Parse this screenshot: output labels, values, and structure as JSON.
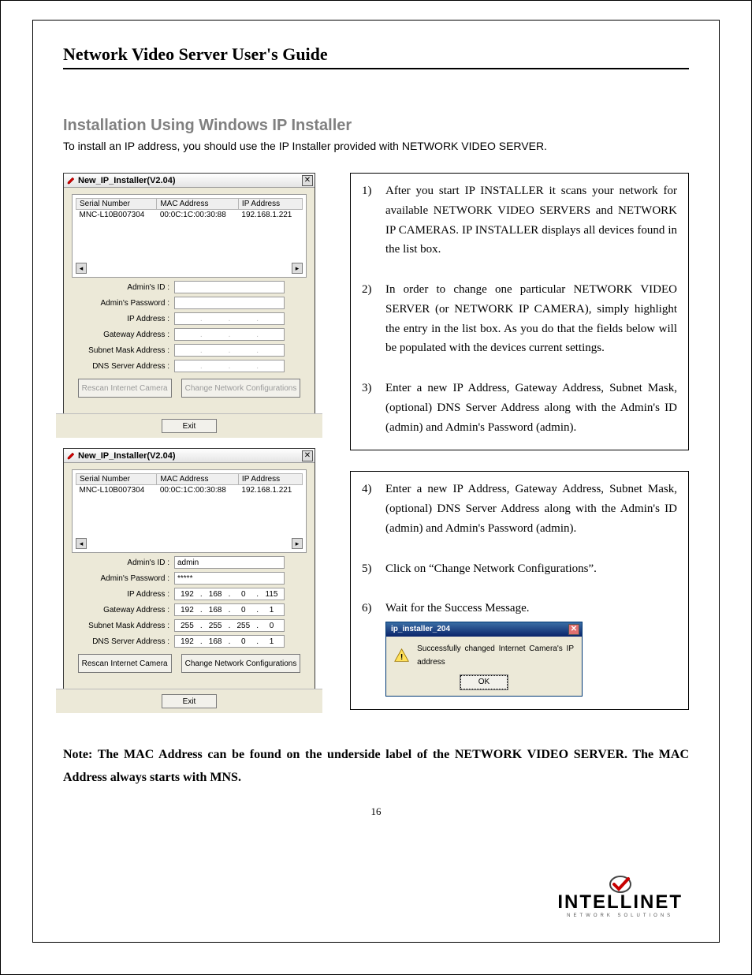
{
  "doc": {
    "title": "Network Video Server User's Guide",
    "section_title": "Installation Using Windows IP Installer",
    "intro": "To install an IP address, you should use the IP Installer provided with NETWORK VIDEO SERVER.",
    "note": "Note: The MAC Address can be found on the underside label of the NETWORK VIDEO SERVER. The MAC Address always starts with MNS.",
    "page_number": "16",
    "brand_name": "INTELLINET",
    "brand_sub": "NETWORK SOLUTIONS"
  },
  "installer": {
    "window_title": "New_IP_Installer(V2.04)",
    "columns": {
      "serial": "Serial Number",
      "mac": "MAC Address",
      "ip": "IP Address"
    },
    "row": {
      "serial": "MNC-L10B007304",
      "mac": "00:0C:1C:00:30:88",
      "ip": "192.168.1.221"
    },
    "labels": {
      "admin_id": "Admin's ID :",
      "admin_pw": "Admin's Password :",
      "ip": "IP Address :",
      "gw": "Gateway Address :",
      "mask": "Subnet Mask Address :",
      "dns": "DNS Server Address :"
    },
    "buttons": {
      "rescan": "Rescan Internet Camera",
      "change": "Change Network Configurations",
      "exit": "Exit"
    },
    "filled": {
      "admin_id": "admin",
      "admin_pw": "*****",
      "ip": [
        "192",
        "168",
        "0",
        "115"
      ],
      "gw": [
        "192",
        "168",
        "0",
        "1"
      ],
      "mask": [
        "255",
        "255",
        "255",
        "0"
      ],
      "dns": [
        "192",
        "168",
        "0",
        "1"
      ]
    }
  },
  "steps_box1": [
    {
      "n": "1)",
      "t": "After you start IP INSTALLER it scans your network for available NETWORK VIDEO SERVERS and NETWORK IP CAMERAS. IP INSTALLER displays all devices found in the list box."
    },
    {
      "n": "2)",
      "t": "In order to change one particular NETWORK VIDEO SERVER (or NETWORK IP CAMERA), simply highlight the entry in the list box. As you do that the fields below will be populated with the devices current settings."
    },
    {
      "n": "3)",
      "t": "Enter a new IP Address, Gateway Address, Subnet Mask, (optional) DNS Server Address along with the Admin's ID (admin) and Admin's Password (admin)."
    }
  ],
  "steps_box2": [
    {
      "n": "4)",
      "t": "Enter a new IP Address, Gateway Address, Subnet Mask, (optional) DNS Server Address along with the Admin's ID (admin) and Admin's Password (admin)."
    },
    {
      "n": "5)",
      "t": "Click on “Change Network Configurations”."
    },
    {
      "n": "6)",
      "t": "Wait for the Success Message."
    }
  ],
  "success_dialog": {
    "title": "ip_installer_204",
    "message": "Successfully changed Internet Camera's IP address",
    "ok": "OK"
  }
}
